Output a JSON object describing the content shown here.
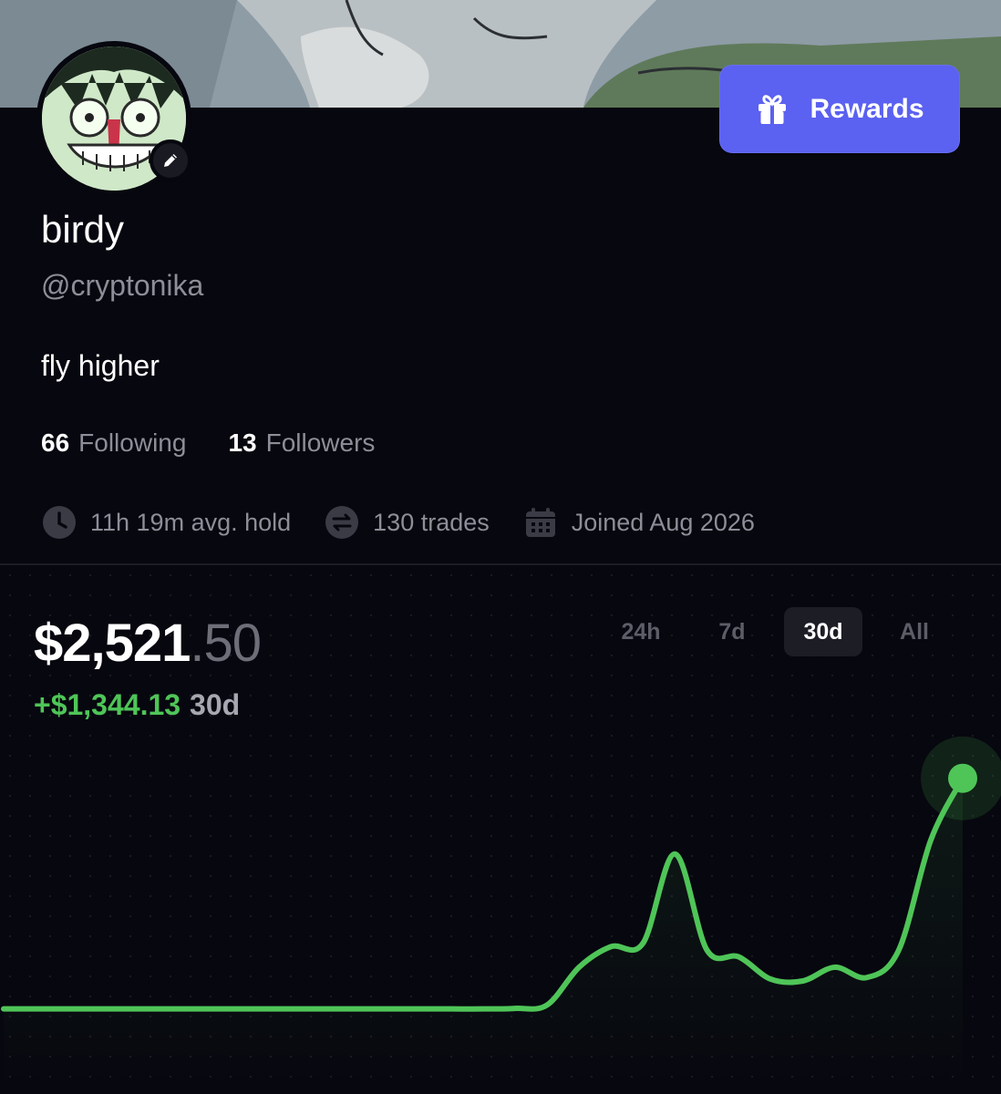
{
  "header": {
    "rewards_label": "Rewards"
  },
  "profile": {
    "display_name": "birdy",
    "handle": "@cryptonika",
    "bio": "fly higher",
    "following_count": "66",
    "following_label": "Following",
    "followers_count": "13",
    "followers_label": "Followers"
  },
  "stats": {
    "avg_hold": "11h 19m avg. hold",
    "trades": "130 trades",
    "joined": "Joined Aug 2026"
  },
  "portfolio": {
    "balance_main": "$2,521",
    "balance_cents": ".50",
    "change_sign": "+",
    "change_value": "$1,344.13",
    "change_period": "30d",
    "ranges": [
      "24h",
      "7d",
      "30d",
      "All"
    ],
    "active_range": "30d"
  },
  "colors": {
    "accent": "#5b61f0",
    "positive": "#4fc558",
    "background": "#07070f"
  },
  "icons": {
    "rewards": "gift-icon",
    "edit": "pencil-icon",
    "avg_hold": "clock-icon",
    "trades": "swap-icon",
    "joined": "calendar-icon"
  },
  "chart_data": {
    "type": "line",
    "x": [
      0,
      1,
      2,
      3,
      4,
      5,
      6,
      7,
      8,
      9,
      10,
      11,
      12,
      13,
      14,
      15,
      16,
      17,
      18,
      19,
      20,
      21,
      22,
      23,
      24,
      25,
      26,
      27,
      28,
      29,
      30
    ],
    "series": [
      {
        "values": [
          1177,
          1177,
          1177,
          1177,
          1177,
          1177,
          1177,
          1177,
          1177,
          1177,
          1177,
          1177,
          1177,
          1177,
          1177,
          1177,
          1180,
          1200,
          1420,
          1540,
          1560,
          2080,
          1520,
          1480,
          1350,
          1340,
          1420,
          1360,
          1520,
          2160,
          2521
        ]
      }
    ],
    "ylim": [
      1000,
      2700
    ],
    "grid": true
  }
}
